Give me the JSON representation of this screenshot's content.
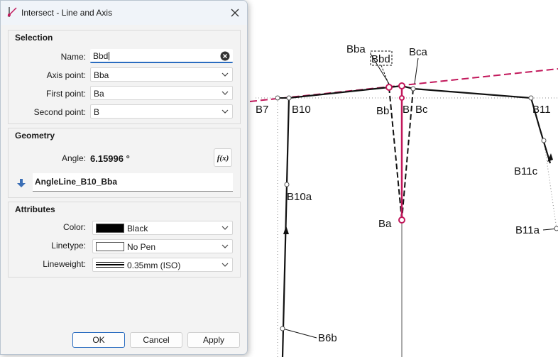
{
  "dialog": {
    "title": "Intersect - Line and Axis",
    "selection": {
      "heading": "Selection",
      "name_label": "Name:",
      "name_value": "Bbd",
      "axis_point_label": "Axis point:",
      "axis_point_value": "Bba",
      "first_point_label": "First point:",
      "first_point_value": "Ba",
      "second_point_label": "Second point:",
      "second_point_value": "B"
    },
    "geometry": {
      "heading": "Geometry",
      "angle_label": "Angle:",
      "angle_value": "6.15996 °",
      "formula_button": "f(x)",
      "angle_line": "AngleLine_B10_Bba"
    },
    "attributes": {
      "heading": "Attributes",
      "color_label": "Color:",
      "color_value": "Black",
      "linetype_label": "Linetype:",
      "linetype_value": "No Pen",
      "lineweight_label": "Lineweight:",
      "lineweight_value": "0.35mm (ISO)"
    },
    "buttons": {
      "ok": "OK",
      "cancel": "Cancel",
      "apply": "Apply"
    }
  },
  "canvas_labels": {
    "bba": "Bba",
    "bbd": "Bbd",
    "bca": "Bca",
    "b7": "B7",
    "b10": "B10",
    "bb": "Bb",
    "b": "B",
    "bc": "Bc",
    "b11": "B11",
    "b11c": "B11c",
    "b10a": "B10a",
    "ba": "Ba",
    "b11a": "B11a",
    "b6b": "B6b"
  },
  "colors": {
    "accent": "#2a6cc0",
    "highlight": "#c2185b",
    "line": "#111111"
  },
  "icons": {
    "title": "intersect-tool-icon",
    "close": "close-icon",
    "clear": "clear-text-icon",
    "dropdown": "chevron-down-icon",
    "formula": "formula-icon",
    "arrow": "down-arrow-icon"
  }
}
